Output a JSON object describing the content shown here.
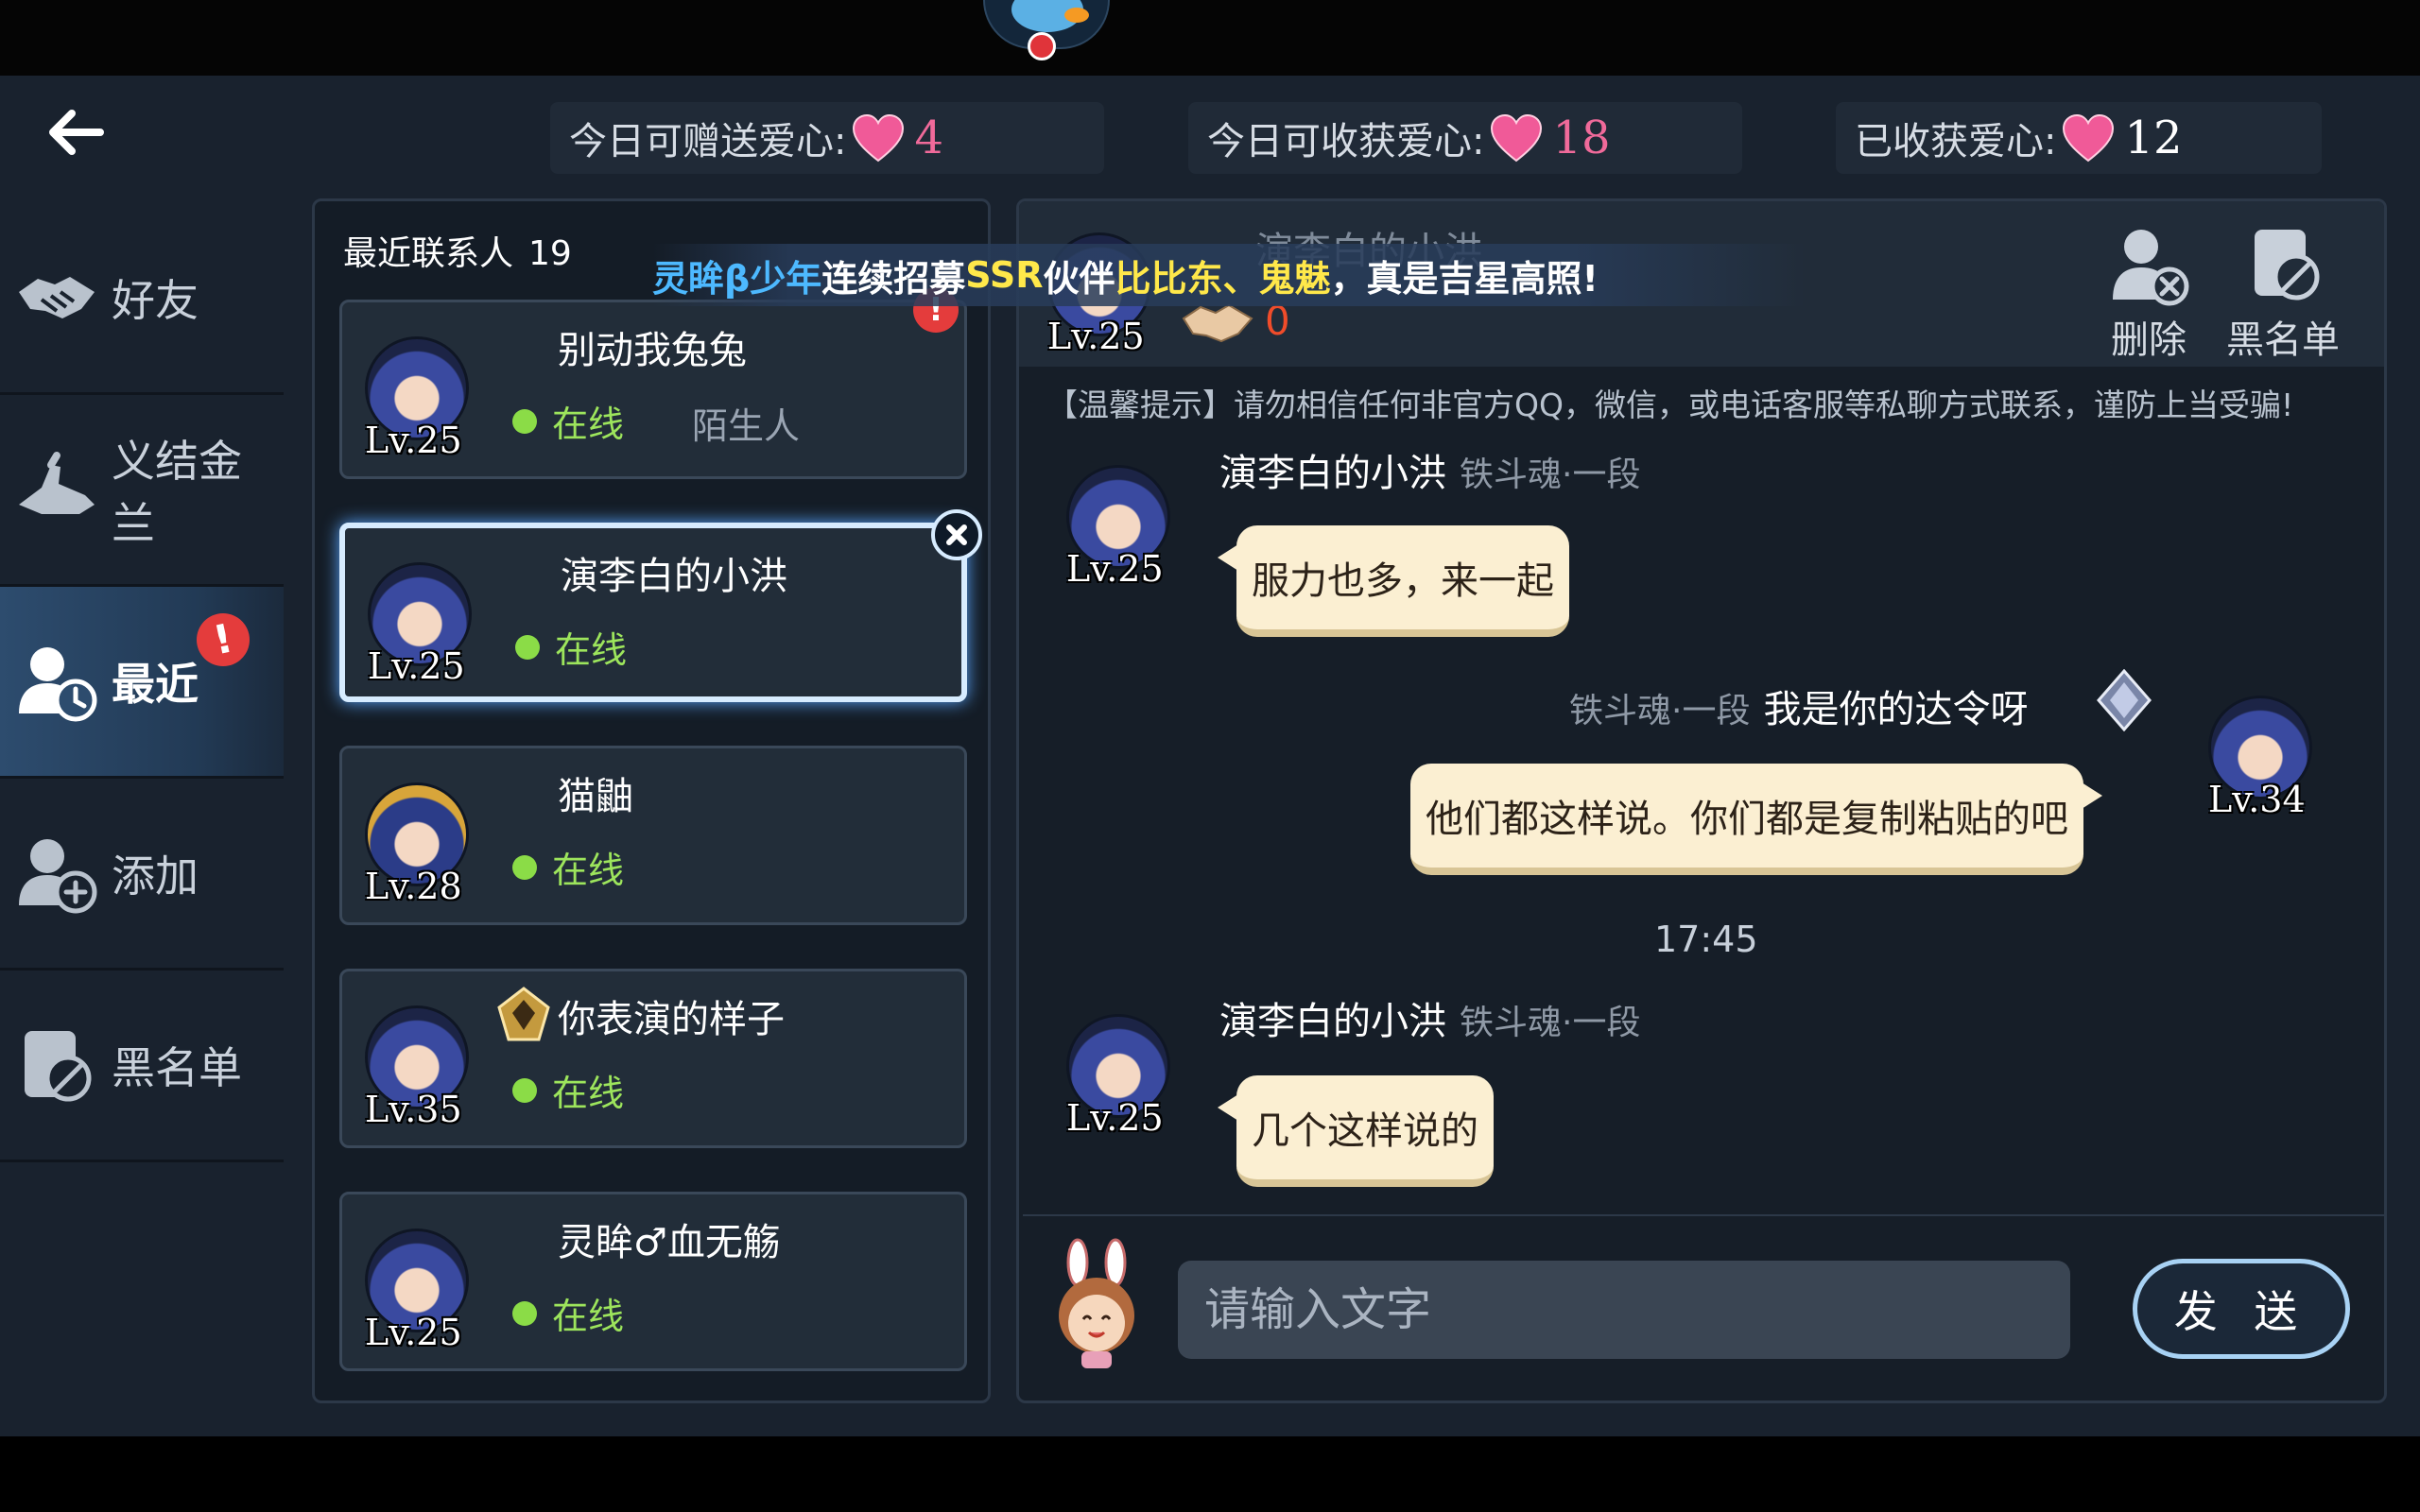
{
  "hearts": {
    "give_label": "今日可赠送爱心:",
    "give_count": "4",
    "receive_label": "今日可收获爱心:",
    "receive_count": "18",
    "received_label": "已收获爱心:",
    "received_count": "12"
  },
  "nav": {
    "items": [
      {
        "label": "好友",
        "icon": "handshake-icon"
      },
      {
        "label": "义结金兰",
        "icon": "pinky-promise-icon"
      },
      {
        "label": "最近",
        "icon": "recent-contact-icon",
        "active": true,
        "badge": "!"
      },
      {
        "label": "添加",
        "icon": "add-friend-icon"
      },
      {
        "label": "黑名单",
        "icon": "blacklist-icon"
      }
    ]
  },
  "contacts": {
    "header_label": "最近联系人",
    "count": "19",
    "items": [
      {
        "name": "别动我兔兔",
        "level": "Lv.25",
        "status": "在线",
        "tag": "陌生人",
        "badge": "!"
      },
      {
        "name": "演李白的小洪",
        "level": "Lv.25",
        "status": "在线",
        "selected": true
      },
      {
        "name": "猫鼬",
        "level": "Lv.28",
        "status": "在线"
      },
      {
        "name": "你表演的样子",
        "level": "Lv.35",
        "status": "在线",
        "rank_icon": "gold-rank-icon"
      },
      {
        "name": "灵眸♂血无觞",
        "level": "Lv.25",
        "status": "在线"
      }
    ]
  },
  "chat": {
    "header": {
      "name": "演李白的小洪",
      "level": "Lv.25",
      "hearts": "0",
      "delete_label": "删除",
      "blacklist_label": "黑名单"
    },
    "announcement": {
      "player": "灵眸β少年",
      "text1": "连续招募",
      "rarity": "SSR",
      "text2": "伙伴",
      "partners": "比比东、鬼魅",
      "text3": "，真是吉星高照!"
    },
    "tip": "【温馨提示】请勿相信任何非官方QQ，微信，或电话客服等私聊方式联系，谨防上当受骗!",
    "messages": [
      {
        "sender": "演李白的小洪",
        "rank": "铁斗魂·一段",
        "level": "Lv.25",
        "text": "服力也多，来一起"
      },
      {
        "sender": "我是你的达令呀",
        "rank": "铁斗魂·一段",
        "level": "Lv.34",
        "text": "他们都这样说。你们都是复制粘贴的吧"
      },
      {
        "sender": "演李白的小洪",
        "rank": "铁斗魂·一段",
        "level": "Lv.25",
        "text": "几个这样说的"
      }
    ],
    "time": "17:45",
    "input_placeholder": "请输入文字",
    "send_label": "发 送"
  },
  "colors": {
    "background": "#19222e",
    "accent_pink": "#f06a9a",
    "online_green": "#8bdc47",
    "bubble": "#fbefd2",
    "badge_red": "#e43c3c"
  }
}
